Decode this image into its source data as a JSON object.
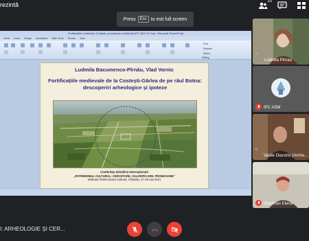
{
  "top_bar": {
    "presenter_label": "rezintă",
    "participants_count": "10"
  },
  "esc_toast": {
    "press": "Press",
    "key": "Esc",
    "rest": "to exit full screen"
  },
  "shared_screen": {
    "window_title": "Fortificatiile medievale Costesti_cuvuntoare conferinta IPC 2021 27 mai  -  Microsoft PowerPoint",
    "ribbon_tabs": [
      "Home",
      "Insert",
      "Design",
      "Animations",
      "Slide Show",
      "Review",
      "View"
    ],
    "ribbon_labels": {
      "find": "Find",
      "replace": "Replace",
      "select": "Select",
      "editing": "Editing"
    },
    "slide": {
      "authors": "Ludmila Bacumenco-Pîrnău, Vlad Vornic",
      "title_line1": "Fortificațiile medievale de la Costești-Gârlea de pe râul Botna:",
      "title_line2": "descoperiri arheologice și ipoteze",
      "conf_line1": "Conferința Științifică Internațională",
      "conf_line2": "„PATRIMONIUL CULTURAL: CERCETARE, VALORIFICARE, PROMOVARE\"",
      "conf_line3": "Institutul Patrimoniului Cultural, Chișinău, 27-28 mai 2021"
    }
  },
  "participants": [
    {
      "name": "Ludmila Pirnau",
      "muted": false
    },
    {
      "name": "IPC ASM",
      "muted": true
    },
    {
      "name": "Vasile Diaconu (Arche...",
      "muted": false
    },
    {
      "name": "Gherman Elena",
      "muted": true
    }
  ],
  "bottom_bar": {
    "meeting_title": "I: ARHEOLOGIE ȘI CER...",
    "colors": {
      "danger": "#ea4335",
      "background": "#202124"
    }
  }
}
